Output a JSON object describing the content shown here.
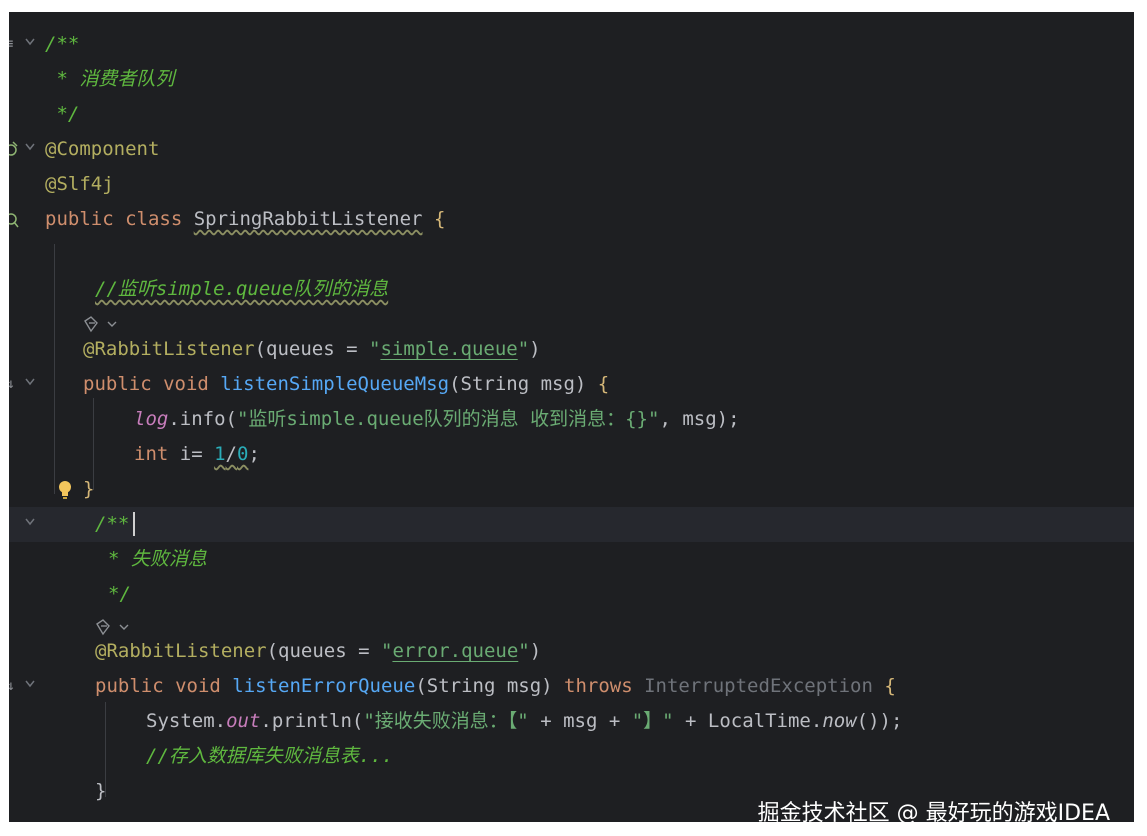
{
  "editor": {
    "lines": [
      {
        "id": "l1",
        "parts": [
          "/**"
        ]
      },
      {
        "id": "l2",
        "parts": [
          " * 消费者队列"
        ]
      },
      {
        "id": "l3",
        "parts": [
          " */"
        ]
      },
      {
        "id": "l4",
        "parts": [
          "@Component"
        ]
      },
      {
        "id": "l5",
        "parts": [
          "@Slf4j"
        ]
      },
      {
        "id": "l6",
        "parts": [
          "public class ",
          "SpringRabbitListener",
          " ",
          "{"
        ]
      },
      {
        "id": "l8",
        "parts": [
          "//监听simple.queue队列的消息"
        ]
      },
      {
        "id": "l10",
        "parts": [
          "@RabbitListener",
          "(queues = ",
          "\"",
          "simple.queue",
          "\"",
          ")"
        ]
      },
      {
        "id": "l11",
        "parts": [
          "public void ",
          "listenSimpleQueueMsg",
          "(String msg) ",
          "{"
        ]
      },
      {
        "id": "l12",
        "parts": [
          "log",
          ".info(",
          "\"监听simple.queue队列的消息 收到消息：{}\"",
          ", msg);"
        ]
      },
      {
        "id": "l13",
        "parts": [
          "int ",
          "i= ",
          "1",
          "/",
          "0",
          ";"
        ]
      },
      {
        "id": "l14",
        "parts": [
          "}"
        ]
      },
      {
        "id": "l15",
        "parts": [
          "/**"
        ]
      },
      {
        "id": "l16",
        "parts": [
          "* 失败消息"
        ]
      },
      {
        "id": "l17",
        "parts": [
          "*/"
        ]
      },
      {
        "id": "l19",
        "parts": [
          "@RabbitListener",
          "(queues = ",
          "\"",
          "error.queue",
          "\"",
          ")"
        ]
      },
      {
        "id": "l20",
        "parts": [
          "public void ",
          "listenErrorQueue",
          "(String msg) ",
          "throws ",
          "InterruptedException ",
          "{"
        ]
      },
      {
        "id": "l21",
        "parts": [
          "System.",
          "out",
          ".println(",
          "\"接收失败消息：【\"",
          " + msg + ",
          "\"】\"",
          " + LocalTime.",
          "now",
          "());"
        ]
      },
      {
        "id": "l22",
        "parts": [
          "//存入数据库失败消息表..."
        ]
      },
      {
        "id": "l23",
        "parts": [
          "}"
        ]
      }
    ]
  },
  "icons": {
    "fold": "chevron-down-icon",
    "bean": "spring-bean-icon",
    "listener": "rabbit-listener-icon",
    "intention": "lightbulb-icon"
  },
  "colors": {
    "background": "#1e1f22",
    "keyword": "#cf8e6d",
    "annotation": "#b3ae60",
    "method": "#56a8f5",
    "string": "#6aab73",
    "comment": "#5fb83f"
  },
  "watermark": "掘金技术社区 @ 最好玩的游戏IDEA"
}
